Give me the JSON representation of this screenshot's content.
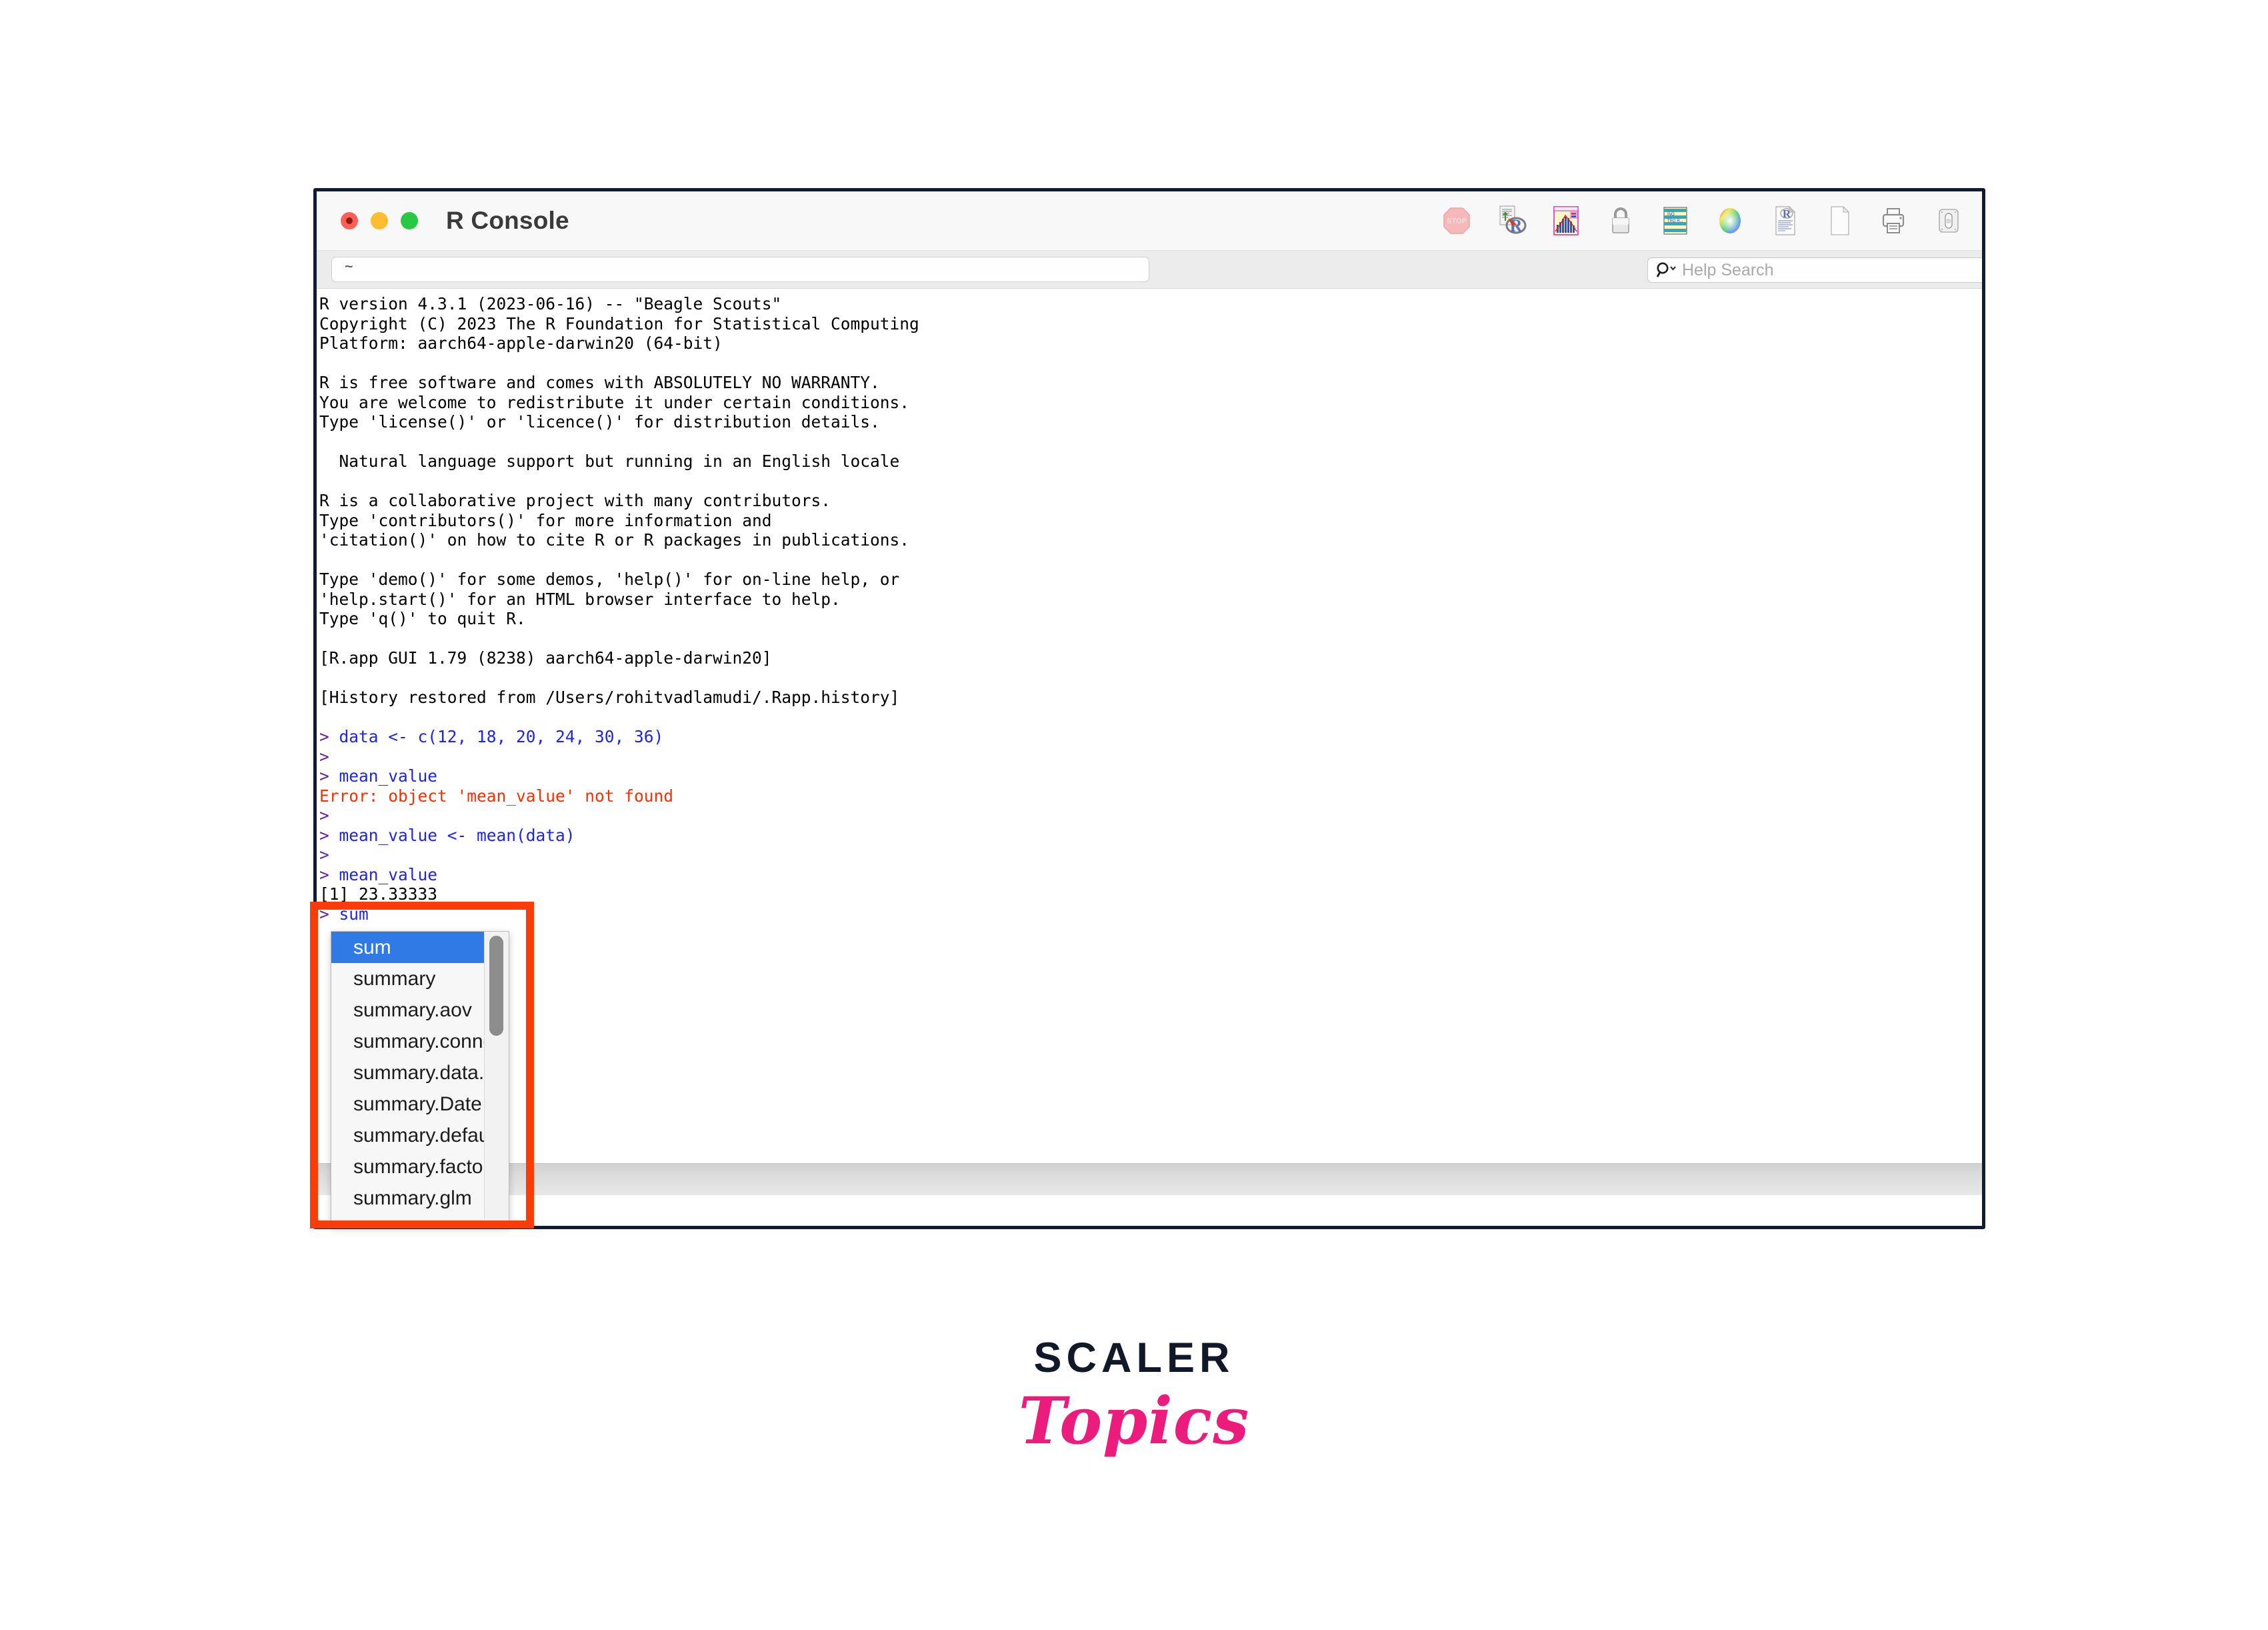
{
  "window": {
    "title": "R Console",
    "traffic_lights": [
      "close",
      "minimize",
      "zoom"
    ]
  },
  "toolbar": {
    "icons": [
      {
        "name": "stop-icon",
        "label": "STOP"
      },
      {
        "name": "source-r-script-icon",
        "label": "Source R Script"
      },
      {
        "name": "show-plot-histogram-icon",
        "label": "Plot Window"
      },
      {
        "name": "lock-icon",
        "label": "Lock"
      },
      {
        "name": "data-grid-icon",
        "label": "Data Viewer"
      },
      {
        "name": "color-picker-icon",
        "label": "Color Picker"
      },
      {
        "name": "r-document-icon",
        "label": "R Document"
      },
      {
        "name": "new-document-icon",
        "label": "New Document"
      },
      {
        "name": "print-icon",
        "label": "Print"
      },
      {
        "name": "toggle-switch-icon",
        "label": "Toggle"
      }
    ]
  },
  "subbar": {
    "path_value": "~",
    "help_search_placeholder": "Help Search",
    "help_search_value": "",
    "search_icon": "magnifier-chevron-icon"
  },
  "console": {
    "lines": [
      {
        "segments": [
          {
            "text": "R version 4.3.1 (2023-06-16) -- \"Beagle Scouts\"",
            "color": "black"
          }
        ]
      },
      {
        "segments": [
          {
            "text": "Copyright (C) 2023 The R Foundation for Statistical Computing",
            "color": "black"
          }
        ]
      },
      {
        "segments": [
          {
            "text": "Platform: aarch64-apple-darwin20 (64-bit)",
            "color": "black"
          }
        ]
      },
      {
        "segments": [
          {
            "text": "",
            "color": "black"
          }
        ]
      },
      {
        "segments": [
          {
            "text": "R is free software and comes with ABSOLUTELY NO WARRANTY.",
            "color": "black"
          }
        ]
      },
      {
        "segments": [
          {
            "text": "You are welcome to redistribute it under certain conditions.",
            "color": "black"
          }
        ]
      },
      {
        "segments": [
          {
            "text": "Type 'license()' or 'licence()' for distribution details.",
            "color": "black"
          }
        ]
      },
      {
        "segments": [
          {
            "text": "",
            "color": "black"
          }
        ]
      },
      {
        "segments": [
          {
            "text": "  Natural language support but running in an English locale",
            "color": "black"
          }
        ]
      },
      {
        "segments": [
          {
            "text": "",
            "color": "black"
          }
        ]
      },
      {
        "segments": [
          {
            "text": "R is a collaborative project with many contributors.",
            "color": "black"
          }
        ]
      },
      {
        "segments": [
          {
            "text": "Type 'contributors()' for more information and",
            "color": "black"
          }
        ]
      },
      {
        "segments": [
          {
            "text": "'citation()' on how to cite R or R packages in publications.",
            "color": "black"
          }
        ]
      },
      {
        "segments": [
          {
            "text": "",
            "color": "black"
          }
        ]
      },
      {
        "segments": [
          {
            "text": "Type 'demo()' for some demos, 'help()' for on-line help, or",
            "color": "black"
          }
        ]
      },
      {
        "segments": [
          {
            "text": "'help.start()' for an HTML browser interface to help.",
            "color": "black"
          }
        ]
      },
      {
        "segments": [
          {
            "text": "Type 'q()' to quit R.",
            "color": "black"
          }
        ]
      },
      {
        "segments": [
          {
            "text": "",
            "color": "black"
          }
        ]
      },
      {
        "segments": [
          {
            "text": "[R.app GUI 1.79 (8238) aarch64-apple-darwin20]",
            "color": "black"
          }
        ]
      },
      {
        "segments": [
          {
            "text": "",
            "color": "black"
          }
        ]
      },
      {
        "segments": [
          {
            "text": "[History restored from /Users/rohitvadlamudi/.Rapp.history]",
            "color": "black"
          }
        ]
      },
      {
        "segments": [
          {
            "text": "",
            "color": "black"
          }
        ]
      },
      {
        "segments": [
          {
            "text": "> ",
            "color": "prompt"
          },
          {
            "text": "data <- c(12, 18, 20, 24, 30, 36)",
            "color": "blue"
          }
        ]
      },
      {
        "segments": [
          {
            "text": "> ",
            "color": "prompt"
          }
        ]
      },
      {
        "segments": [
          {
            "text": "> ",
            "color": "prompt"
          },
          {
            "text": "mean_value",
            "color": "blue"
          }
        ]
      },
      {
        "segments": [
          {
            "text": "Error: object 'mean_value' not found",
            "color": "red"
          }
        ]
      },
      {
        "segments": [
          {
            "text": "> ",
            "color": "prompt"
          }
        ]
      },
      {
        "segments": [
          {
            "text": "> ",
            "color": "prompt"
          },
          {
            "text": "mean_value <- mean(data)",
            "color": "blue"
          }
        ]
      },
      {
        "segments": [
          {
            "text": "> ",
            "color": "prompt"
          }
        ]
      },
      {
        "segments": [
          {
            "text": "> ",
            "color": "prompt"
          },
          {
            "text": "mean_value",
            "color": "blue"
          }
        ]
      },
      {
        "segments": [
          {
            "text": "[1] 23.33333",
            "color": "black"
          }
        ]
      },
      {
        "segments": [
          {
            "text": "> ",
            "color": "prompt"
          },
          {
            "text": "sum",
            "color": "blue"
          }
        ]
      }
    ]
  },
  "autocomplete": {
    "items": [
      {
        "label": "sum",
        "selected": true
      },
      {
        "label": "summary",
        "selected": false
      },
      {
        "label": "summary.aov",
        "selected": false
      },
      {
        "label": "summary.connec…",
        "selected": false
      },
      {
        "label": "summary.data.fra…",
        "selected": false
      },
      {
        "label": "summary.Date",
        "selected": false
      },
      {
        "label": "summary.default",
        "selected": false
      },
      {
        "label": "summary.factor",
        "selected": false
      },
      {
        "label": "summary.glm",
        "selected": false
      }
    ],
    "scrollbar": "vertical-scrollbar"
  },
  "annotation": {
    "color": "#fa3b0a",
    "shape": "rectangle-highlight"
  },
  "logo": {
    "brand": "SCALER",
    "sub": "Topics",
    "brand_color": "#111827",
    "sub_color": "#ec1c7d"
  }
}
